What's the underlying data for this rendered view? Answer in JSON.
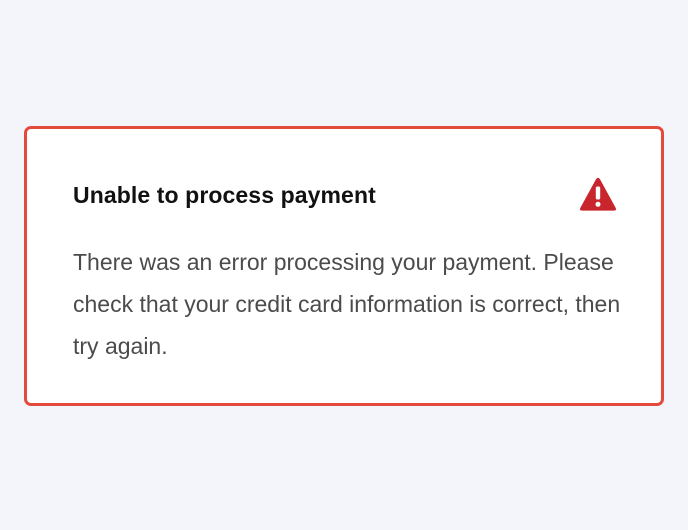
{
  "alert": {
    "title": "Unable to process payment",
    "message": "There was an error processing your payment. Please check that your credit card information is correct, then try again.",
    "icon": "alert-triangle-icon",
    "colors": {
      "border": "#e34a3b",
      "icon": "#c9252d",
      "background": "#ffffff",
      "page_background": "#f4f5fa"
    }
  }
}
